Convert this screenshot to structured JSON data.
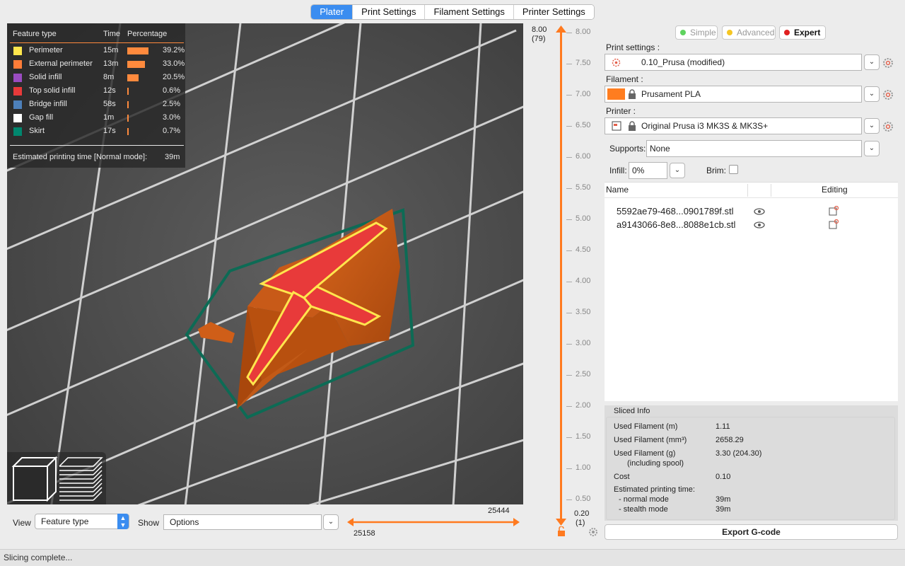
{
  "tabs": [
    {
      "label": "Plater",
      "active": true
    },
    {
      "label": "Print Settings"
    },
    {
      "label": "Filament Settings"
    },
    {
      "label": "Printer Settings"
    }
  ],
  "legend": {
    "col_feature": "Feature type",
    "col_time": "Time",
    "col_pct": "Percentage",
    "rows": [
      {
        "name": "Perimeter",
        "time": "15m",
        "pct": "39.2%",
        "color": "#ffe64d",
        "frac": 0.392
      },
      {
        "name": "External perimeter",
        "time": "13m",
        "pct": "33.0%",
        "color": "#ff7d38",
        "frac": 0.33
      },
      {
        "name": "Solid infill",
        "time": "8m",
        "pct": "20.5%",
        "color": "#9a4cc1",
        "frac": 0.205
      },
      {
        "name": "Top solid infill",
        "time": "12s",
        "pct": "0.6%",
        "color": "#e83a3a",
        "frac": 0.006
      },
      {
        "name": "Bridge infill",
        "time": "58s",
        "pct": "2.5%",
        "color": "#4d80ba",
        "frac": 0.025
      },
      {
        "name": "Gap fill",
        "time": "1m",
        "pct": "3.0%",
        "color": "#ffffff",
        "frac": 0.03
      },
      {
        "name": "Skirt",
        "time": "17s",
        "pct": "0.7%",
        "color": "#00876e",
        "frac": 0.007
      }
    ],
    "est_label": "Estimated printing time [Normal mode]:",
    "est_value": "39m"
  },
  "vslider": {
    "top_value": "8.00",
    "top_layer": "(79)",
    "bottom_value": "0.20",
    "bottom_layer": "(1)",
    "ticks": [
      "8.00",
      "7.50",
      "7.00",
      "6.50",
      "6.00",
      "5.50",
      "5.00",
      "4.50",
      "4.00",
      "3.50",
      "3.00",
      "2.50",
      "2.00",
      "1.50",
      "1.00",
      "0.50"
    ]
  },
  "bottom": {
    "view_label": "View",
    "view_value": "Feature type",
    "show_label": "Show",
    "show_value": "Options",
    "h_top": "25444",
    "h_bottom": "25158"
  },
  "mode": {
    "simple": "Simple",
    "advanced": "Advanced",
    "expert": "Expert",
    "simple_color": "#5fd35f",
    "advanced_color": "#f5c623",
    "expert_color": "#e02020"
  },
  "settings": {
    "print_label": "Print settings :",
    "print_value": "0.10_Prusa (modified)",
    "filament_label": "Filament :",
    "filament_value": "Prusament PLA",
    "filament_color": "#ff7d1f",
    "printer_label": "Printer :",
    "printer_value": "Original Prusa i3 MK3S & MK3S+",
    "supports_label": "Supports:",
    "supports_value": "None",
    "infill_label": "Infill:",
    "infill_value": "0%",
    "brim_label": "Brim:"
  },
  "objects": {
    "col_name": "Name",
    "col_editing": "Editing",
    "items": [
      "5592ae79-468...0901789f.stl",
      "a9143066-8e8...8088e1cb.stl"
    ]
  },
  "sliced": {
    "title": "Sliced Info",
    "used_m_label": "Used Filament (m)",
    "used_m": "1.11",
    "used_mm3_label": "Used Filament (mm³)",
    "used_mm3": "2658.29",
    "used_g_label": "Used Filament (g)",
    "used_g_sub": "(including spool)",
    "used_g": "3.30 (204.30)",
    "cost_label": "Cost",
    "cost": "0.10",
    "est_label": "Estimated printing time:",
    "normal_label": "- normal mode",
    "normal": "39m",
    "stealth_label": "- stealth mode",
    "stealth": "39m"
  },
  "export_label": "Export G-code",
  "status": "Slicing complete..."
}
